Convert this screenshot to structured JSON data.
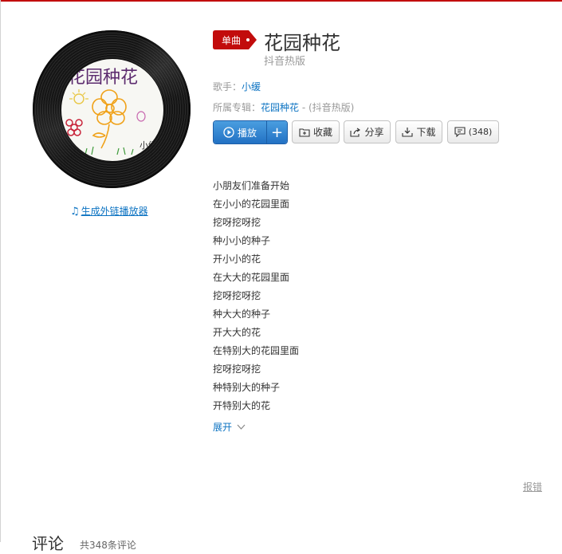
{
  "cover": {
    "handwritten_text": "花园种花",
    "signature": "小缓"
  },
  "generate_link": {
    "label": "生成外链播放器"
  },
  "song": {
    "badge": "单曲",
    "title": "花园种花",
    "subtitle": "抖音热版",
    "singer_label": "歌手：",
    "singer": "小缓",
    "album_label": "所属专辑：",
    "album": "花园种花",
    "album_suffix": " - (抖音热版)"
  },
  "actions": {
    "play": "播放",
    "add": "+",
    "collect": "收藏",
    "share": "分享",
    "download": "下载",
    "comment_count": "(348)"
  },
  "lyrics": [
    "小朋友们准备开始",
    "在小小的花园里面",
    "挖呀挖呀挖",
    "种小小的种子",
    "开小小的花",
    "在大大的花园里面",
    "挖呀挖呀挖",
    "种大大的种子",
    "开大大的花",
    "在特别大的花园里面",
    "挖呀挖呀挖",
    "种特别大的种子",
    "开特别大的花"
  ],
  "expand_label": "展开",
  "report_label": "报错",
  "comments": {
    "title": "评论",
    "count_text": "共348条评论"
  },
  "colors": {
    "accent_red": "#c20c0c",
    "link_blue": "#0c73c2",
    "play_blue": "#2271c4"
  }
}
